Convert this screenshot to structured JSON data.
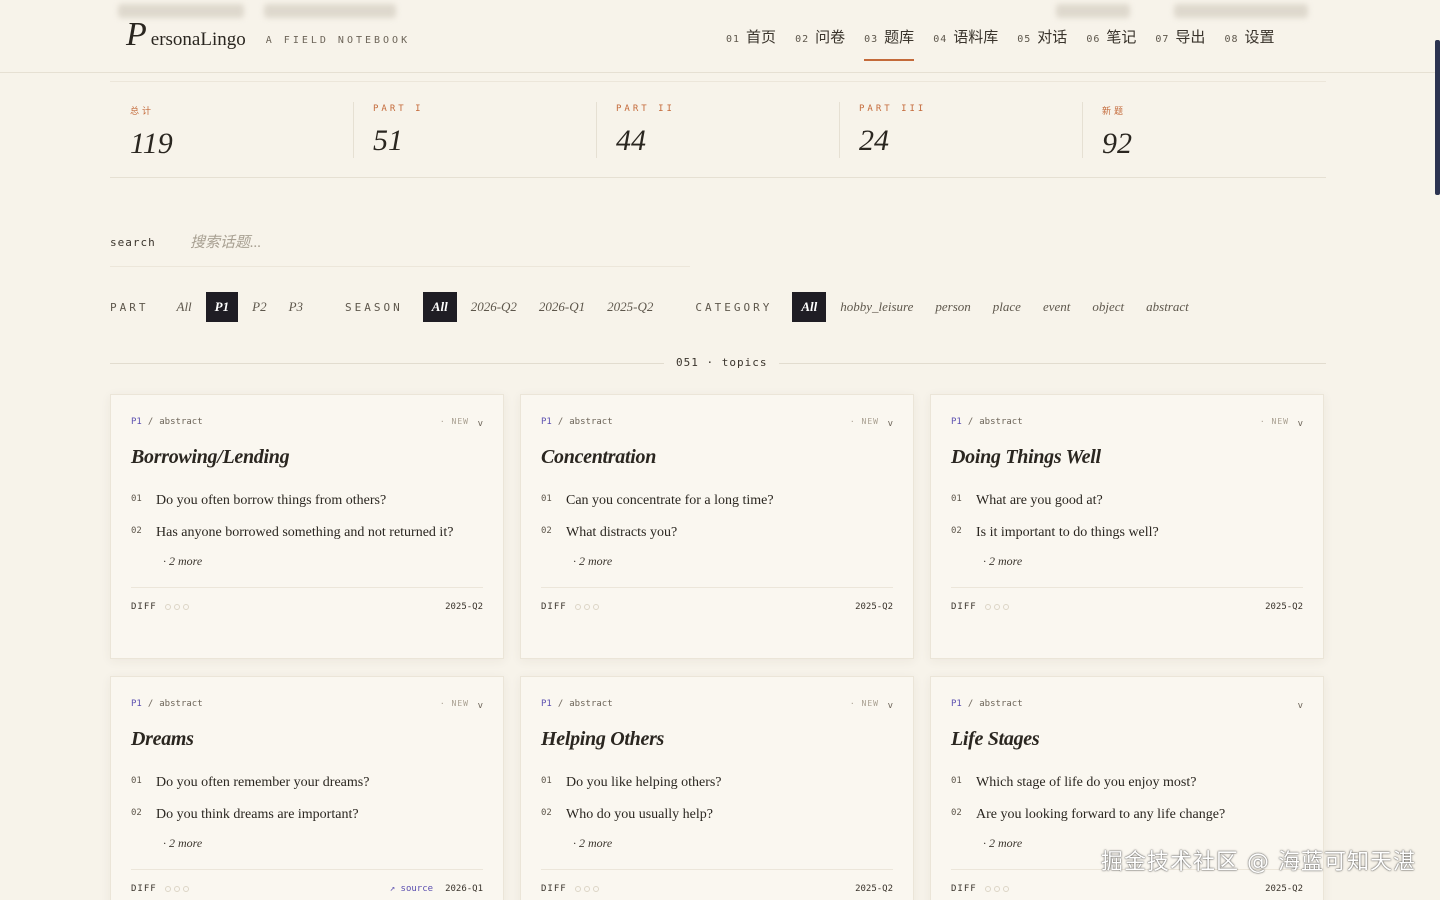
{
  "brand": {
    "initial": "P",
    "rest": "ersonaLingo",
    "subtitle": "A FIELD NOTEBOOK"
  },
  "nav": [
    {
      "num": "01",
      "label": "首页"
    },
    {
      "num": "02",
      "label": "问卷"
    },
    {
      "num": "03",
      "label": "题库",
      "active": true
    },
    {
      "num": "04",
      "label": "语料库"
    },
    {
      "num": "05",
      "label": "对话"
    },
    {
      "num": "06",
      "label": "笔记"
    },
    {
      "num": "07",
      "label": "导出"
    },
    {
      "num": "08",
      "label": "设置"
    }
  ],
  "stats": [
    {
      "label": "总计",
      "value": "119"
    },
    {
      "label": "PART I",
      "value": "51"
    },
    {
      "label": "PART II",
      "value": "44"
    },
    {
      "label": "PART III",
      "value": "24"
    },
    {
      "label": "新题",
      "value": "92"
    }
  ],
  "search": {
    "label": "search",
    "placeholder": "搜索话题..."
  },
  "filters": {
    "part": {
      "label": "PART",
      "options": [
        "All",
        "P1",
        "P2",
        "P3"
      ],
      "active": "P1"
    },
    "season": {
      "label": "SEASON",
      "options": [
        "All",
        "2026-Q2",
        "2026-Q1",
        "2025-Q2"
      ],
      "active": "All"
    },
    "category": {
      "label": "CATEGORY",
      "options": [
        "All",
        "hobby_leisure",
        "person",
        "place",
        "event",
        "object",
        "abstract"
      ],
      "active": "All"
    }
  },
  "count": {
    "text": "051 · topics"
  },
  "cards": [
    {
      "part": "P1",
      "category": "abstract",
      "badge": "· NEW",
      "title": "Borrowing/Lending",
      "questions": [
        {
          "num": "01",
          "text": "Do you often borrow things from others?"
        },
        {
          "num": "02",
          "text": "Has anyone borrowed something and not returned it?"
        }
      ],
      "more": "· 2 more",
      "diff": "DIFF",
      "source": "",
      "season": "2025-Q2"
    },
    {
      "part": "P1",
      "category": "abstract",
      "badge": "· NEW",
      "title": "Concentration",
      "questions": [
        {
          "num": "01",
          "text": "Can you concentrate for a long time?"
        },
        {
          "num": "02",
          "text": "What distracts you?"
        }
      ],
      "more": "· 2 more",
      "diff": "DIFF",
      "source": "",
      "season": "2025-Q2"
    },
    {
      "part": "P1",
      "category": "abstract",
      "badge": "· NEW",
      "title": "Doing Things Well",
      "questions": [
        {
          "num": "01",
          "text": "What are you good at?"
        },
        {
          "num": "02",
          "text": "Is it important to do things well?"
        }
      ],
      "more": "· 2 more",
      "diff": "DIFF",
      "source": "",
      "season": "2025-Q2"
    },
    {
      "part": "P1",
      "category": "abstract",
      "badge": "· NEW",
      "title": "Dreams",
      "questions": [
        {
          "num": "01",
          "text": "Do you often remember your dreams?"
        },
        {
          "num": "02",
          "text": "Do you think dreams are important?"
        }
      ],
      "more": "· 2 more",
      "diff": "DIFF",
      "source": "↗ source",
      "season": "2026-Q1"
    },
    {
      "part": "P1",
      "category": "abstract",
      "badge": "· NEW",
      "title": "Helping Others",
      "questions": [
        {
          "num": "01",
          "text": "Do you like helping others?"
        },
        {
          "num": "02",
          "text": "Who do you usually help?"
        }
      ],
      "more": "· 2 more",
      "diff": "DIFF",
      "source": "",
      "season": "2025-Q2"
    },
    {
      "part": "P1",
      "category": "abstract",
      "badge": "",
      "title": "Life Stages",
      "questions": [
        {
          "num": "01",
          "text": "Which stage of life do you enjoy most?"
        },
        {
          "num": "02",
          "text": "Are you looking forward to any life change?"
        }
      ],
      "more": "· 2 more",
      "diff": "DIFF",
      "source": "",
      "season": "2025-Q2"
    }
  ],
  "watermark": "掘金技术社区 @ 海蓝可知天湛",
  "colors": {
    "accent": "#c46a3a",
    "ink": "#1f1d24",
    "part_tag": "#5b4fb0",
    "background": "#f7f3ea"
  }
}
